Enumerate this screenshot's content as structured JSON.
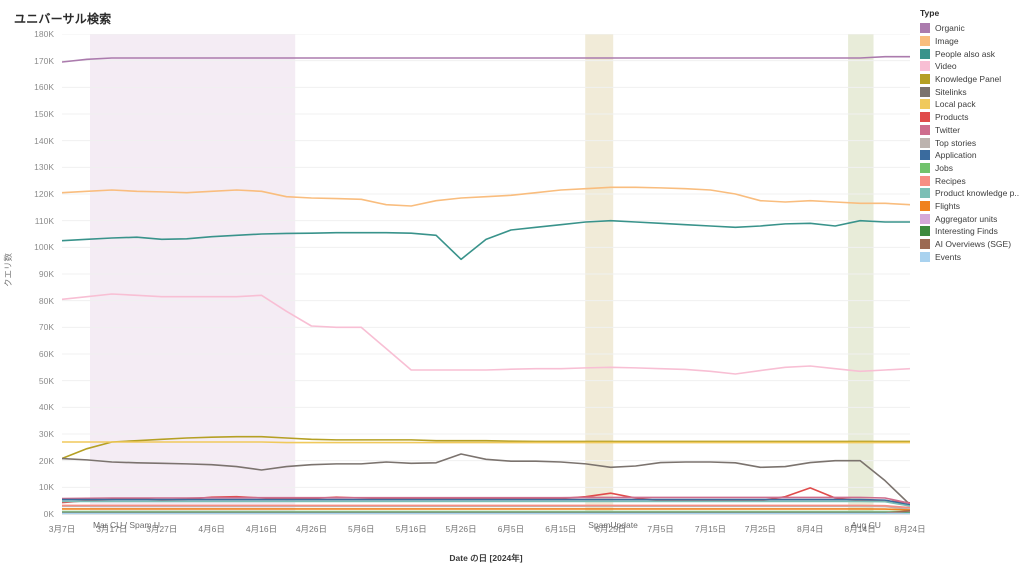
{
  "title": "ユニバーサル検索",
  "axes": {
    "y_title": "クエリ数",
    "x_title": "Date の日 [2024年]",
    "y_ticks": [
      "180K",
      "170K",
      "160K",
      "150K",
      "140K",
      "130K",
      "120K",
      "110K",
      "100K",
      "90K",
      "80K",
      "70K",
      "60K",
      "50K",
      "40K",
      "30K",
      "20K",
      "10K",
      "0K"
    ],
    "x_ticks": [
      "3月7日",
      "3月17日",
      "3月27日",
      "4月6日",
      "4月16日",
      "4月26日",
      "5月6日",
      "5月16日",
      "5月26日",
      "6月5日",
      "6月15日",
      "6月25日",
      "7月5日",
      "7月15日",
      "7月25日",
      "8月4日",
      "8月14日",
      "8月24日"
    ]
  },
  "legend": {
    "title": "Type",
    "items": [
      {
        "label": "Organic",
        "color": "#a濃"
      },
      {
        "label": "Image",
        "color": "#f9bd7e"
      },
      {
        "label": "People also ask",
        "color": "#39938b"
      },
      {
        "label": "Video",
        "color": "#f8bfd4"
      },
      {
        "label": "Knowledge Panel",
        "color": "#b5a024"
      },
      {
        "label": "Sitelinks",
        "color": "#7b736e"
      },
      {
        "label": "Local pack",
        "color": "#f0c95c"
      },
      {
        "label": "Products",
        "color": "#e04b4b"
      },
      {
        "label": "Twitter",
        "color": "#ce6d8d"
      },
      {
        "label": "Top stories",
        "color": "#bdb3ae"
      },
      {
        "label": "Application",
        "color": "#3a6b9e"
      },
      {
        "label": "Jobs",
        "color": "#72c36c"
      },
      {
        "label": "Recipes",
        "color": "#f78e84"
      },
      {
        "label": "Product knowledge p..",
        "color": "#7bbfb5"
      },
      {
        "label": "Flights",
        "color": "#f0821e"
      },
      {
        "label": "Aggregator units",
        "color": "#d5a8d8"
      },
      {
        "label": "Interesting Finds",
        "color": "#3e8a3e"
      },
      {
        "label": "AI Overviews (SGE)",
        "color": "#9c6a53"
      },
      {
        "label": "Events",
        "color": "#a9d2ef"
      }
    ]
  },
  "bands": [
    {
      "name": "Mar CU / Spam U",
      "label": "Mar CU / Spam U",
      "x0": 0.033,
      "x1": 0.275,
      "color": "#f4ecf4"
    },
    {
      "name": "SpamUpdate",
      "label": "SpamUpdate",
      "x0": 0.617,
      "x1": 0.65,
      "color": "#f1ebd8"
    },
    {
      "name": "Aug CU",
      "label": "Aug CU",
      "x0": 0.927,
      "x1": 0.957,
      "color": "#e8ecd9"
    }
  ],
  "chart_data": {
    "type": "line",
    "title": "ユニバーサル検索",
    "xlabel": "Date の日 [2024年]",
    "ylabel": "クエリ数",
    "ylim": [
      0,
      180000
    ],
    "grid": true,
    "legend_position": "right",
    "x": [
      "3月7日",
      "3月12日",
      "3月17日",
      "3月22日",
      "3月27日",
      "4月1日",
      "4月6日",
      "4月11日",
      "4月16日",
      "4月21日",
      "4月26日",
      "5月1日",
      "5月6日",
      "5月11日",
      "5月16日",
      "5月21日",
      "5月26日",
      "5月31日",
      "6月5日",
      "6月10日",
      "6月15日",
      "6月20日",
      "6月25日",
      "6月30日",
      "7月5日",
      "7月10日",
      "7月15日",
      "7月20日",
      "7月25日",
      "7月30日",
      "8月4日",
      "8月9日",
      "8月14日",
      "8月19日",
      "8月24日"
    ],
    "series": [
      {
        "name": "Organic",
        "color": "#ab7bad",
        "values": [
          169500,
          170500,
          171000,
          171000,
          171000,
          171000,
          171000,
          171000,
          171000,
          171000,
          171000,
          171000,
          171000,
          171000,
          171000,
          171000,
          171000,
          171000,
          171000,
          171000,
          171000,
          171000,
          171000,
          171000,
          171000,
          171000,
          171000,
          171000,
          171000,
          171000,
          171000,
          171000,
          171000,
          171500,
          171500
        ]
      },
      {
        "name": "Image",
        "color": "#f9bd7e",
        "values": [
          120500,
          121000,
          121500,
          121000,
          120800,
          120500,
          121000,
          121500,
          121000,
          119000,
          118500,
          118300,
          118000,
          116000,
          115500,
          117500,
          118500,
          119000,
          119500,
          120500,
          121500,
          122000,
          122500,
          122500,
          122300,
          122000,
          121500,
          120000,
          117500,
          117000,
          117500,
          117000,
          116500,
          116500,
          116000
        ]
      },
      {
        "name": "People also ask",
        "color": "#39938b",
        "values": [
          102500,
          103000,
          103500,
          103800,
          103000,
          103200,
          104000,
          104500,
          105000,
          105200,
          105300,
          105500,
          105500,
          105500,
          105300,
          104500,
          95500,
          103000,
          106500,
          107500,
          108500,
          109500,
          110000,
          109500,
          109000,
          108500,
          108000,
          107500,
          108000,
          108800,
          109000,
          108000,
          110000,
          109500,
          109500
        ]
      },
      {
        "name": "Video",
        "color": "#f8bfd4",
        "values": [
          80500,
          81500,
          82500,
          82000,
          81500,
          81500,
          81500,
          81500,
          82000,
          76000,
          70500,
          70000,
          70000,
          62000,
          54000,
          54000,
          54000,
          54000,
          54300,
          54500,
          54500,
          54800,
          55000,
          54800,
          54500,
          54200,
          53500,
          52500,
          53800,
          55000,
          55500,
          54500,
          53500,
          54000,
          54500
        ]
      },
      {
        "name": "Knowledge Panel",
        "color": "#b5a024",
        "values": [
          20800,
          24500,
          27000,
          27500,
          28000,
          28500,
          28800,
          29000,
          29000,
          28500,
          28000,
          27800,
          27800,
          27800,
          27800,
          27500,
          27500,
          27500,
          27300,
          27200,
          27200,
          27200,
          27200,
          27200,
          27200,
          27200,
          27200,
          27200,
          27200,
          27200,
          27200,
          27200,
          27200,
          27200,
          27200
        ]
      },
      {
        "name": "Sitelinks",
        "color": "#7b736e",
        "values": [
          20800,
          20300,
          19500,
          19200,
          19000,
          18800,
          18500,
          17800,
          16500,
          17800,
          18500,
          18800,
          18800,
          19500,
          19000,
          19200,
          22500,
          20500,
          19800,
          19800,
          19500,
          18800,
          17500,
          18000,
          19300,
          19500,
          19500,
          19200,
          17500,
          17800,
          19300,
          20000,
          20000,
          12500,
          3500
        ]
      },
      {
        "name": "Local pack",
        "color": "#f0c95c",
        "values": [
          27000,
          27000,
          27000,
          27000,
          27000,
          27000,
          27000,
          27000,
          27000,
          26800,
          26800,
          26800,
          26800,
          26800,
          26800,
          26800,
          26800,
          26800,
          26800,
          26800,
          26800,
          26800,
          26800,
          26800,
          26800,
          26800,
          26800,
          26800,
          26800,
          26800,
          26800,
          26800,
          26800,
          26800,
          26800
        ]
      },
      {
        "name": "Products",
        "color": "#e04b4b",
        "values": [
          4300,
          5000,
          5500,
          5800,
          5200,
          5500,
          6300,
          6500,
          6000,
          5500,
          5800,
          6300,
          6000,
          5800,
          5800,
          5800,
          5800,
          5800,
          5800,
          5800,
          5800,
          6500,
          7800,
          6000,
          5000,
          5000,
          5000,
          5000,
          5000,
          6500,
          9800,
          6000,
          5000,
          5000,
          4200
        ]
      },
      {
        "name": "Twitter",
        "color": "#ce6d8d",
        "values": [
          5800,
          5900,
          6000,
          6000,
          6000,
          6000,
          6100,
          6100,
          6100,
          6100,
          6100,
          6100,
          6100,
          6100,
          6100,
          6100,
          6100,
          6100,
          6100,
          6100,
          6100,
          6200,
          6200,
          6200,
          6200,
          6200,
          6200,
          6200,
          6200,
          6200,
          6200,
          6200,
          6200,
          6000,
          4000
        ]
      },
      {
        "name": "Top stories",
        "color": "#bdb3ae",
        "values": [
          2900,
          2900,
          2900,
          2900,
          2900,
          2900,
          2900,
          2900,
          2900,
          2900,
          2900,
          2900,
          2900,
          2900,
          2900,
          2900,
          2900,
          2900,
          2900,
          2900,
          2900,
          2900,
          2900,
          2900,
          2900,
          2900,
          2900,
          2900,
          2900,
          2900,
          2900,
          2900,
          2900,
          2800,
          1800
        ]
      },
      {
        "name": "Application",
        "color": "#3a6b9e",
        "values": [
          5400,
          5400,
          5400,
          5400,
          5400,
          5400,
          5400,
          5400,
          5400,
          5400,
          5400,
          5400,
          5400,
          5400,
          5400,
          5400,
          5400,
          5400,
          5400,
          5400,
          5400,
          5400,
          5400,
          5400,
          5400,
          5400,
          5400,
          5400,
          5400,
          5400,
          5400,
          5400,
          5400,
          5200,
          3400
        ]
      },
      {
        "name": "Jobs",
        "color": "#72c36c",
        "values": [
          900,
          900,
          900,
          900,
          900,
          900,
          900,
          900,
          900,
          900,
          900,
          900,
          900,
          900,
          900,
          900,
          900,
          900,
          900,
          900,
          900,
          900,
          900,
          900,
          900,
          900,
          900,
          900,
          900,
          900,
          900,
          900,
          900,
          900,
          900
        ]
      },
      {
        "name": "Recipes",
        "color": "#f78e84",
        "values": [
          3200,
          3200,
          3200,
          3200,
          3200,
          3200,
          3200,
          3200,
          3200,
          3200,
          3200,
          3200,
          3200,
          3200,
          3200,
          3200,
          3200,
          3200,
          3200,
          3200,
          3200,
          3200,
          3200,
          3200,
          3200,
          3200,
          3200,
          3200,
          3200,
          3200,
          3200,
          3200,
          3200,
          3100,
          2400
        ]
      },
      {
        "name": "Product knowledge p..",
        "color": "#7bbfb5",
        "values": [
          4700,
          4700,
          4700,
          4700,
          4700,
          4700,
          4700,
          4700,
          4700,
          4700,
          4700,
          4700,
          4700,
          4700,
          4700,
          4700,
          4700,
          4700,
          4700,
          4700,
          4700,
          4700,
          4700,
          4700,
          4700,
          4700,
          4700,
          4700,
          4700,
          4700,
          4700,
          4700,
          4700,
          4600,
          3000
        ]
      },
      {
        "name": "Flights",
        "color": "#f0821e",
        "values": [
          1900,
          1900,
          1900,
          1900,
          1900,
          1900,
          1900,
          1900,
          1900,
          1900,
          1900,
          1900,
          1900,
          1900,
          1900,
          1900,
          1900,
          1900,
          1900,
          1900,
          1900,
          1900,
          1900,
          1900,
          1900,
          1900,
          1900,
          1900,
          1900,
          1900,
          1900,
          1900,
          1900,
          1850,
          1500
        ]
      },
      {
        "name": "Aggregator units",
        "color": "#d5a8d8",
        "values": [
          600,
          600,
          600,
          600,
          600,
          600,
          600,
          600,
          600,
          600,
          600,
          600,
          600,
          600,
          600,
          600,
          600,
          600,
          600,
          600,
          600,
          600,
          600,
          600,
          600,
          600,
          600,
          600,
          600,
          600,
          600,
          600,
          600,
          600,
          600
        ]
      },
      {
        "name": "Interesting Finds",
        "color": "#3e8a3e",
        "values": [
          500,
          500,
          500,
          500,
          500,
          500,
          500,
          500,
          500,
          500,
          500,
          500,
          500,
          500,
          500,
          500,
          500,
          500,
          500,
          500,
          500,
          500,
          500,
          500,
          500,
          500,
          500,
          500,
          500,
          500,
          500,
          500,
          500,
          500,
          500
        ]
      },
      {
        "name": "AI Overviews (SGE)",
        "color": "#9c6a53",
        "values": [
          300,
          300,
          300,
          300,
          300,
          300,
          300,
          300,
          300,
          300,
          300,
          300,
          300,
          300,
          300,
          300,
          300,
          300,
          300,
          300,
          300,
          300,
          300,
          300,
          300,
          300,
          300,
          300,
          300,
          300,
          300,
          300,
          300,
          300,
          1200
        ]
      },
      {
        "name": "Events",
        "color": "#a9d2ef",
        "values": [
          200,
          200,
          200,
          200,
          200,
          200,
          200,
          200,
          200,
          200,
          200,
          200,
          200,
          200,
          200,
          200,
          200,
          200,
          200,
          200,
          200,
          200,
          200,
          200,
          200,
          200,
          200,
          200,
          200,
          200,
          200,
          200,
          200,
          200,
          200
        ]
      }
    ]
  }
}
